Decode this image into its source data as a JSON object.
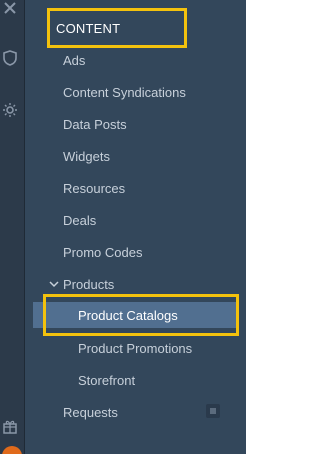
{
  "rail": {
    "icons": [
      "close-icon",
      "shield-icon",
      "settings-icon",
      "gift-icon"
    ],
    "avatar_color": "#e06a1b"
  },
  "sidebar": {
    "section_title": "CONTENT",
    "items": [
      {
        "label": "Ads"
      },
      {
        "label": "Content Syndications"
      },
      {
        "label": "Data Posts"
      },
      {
        "label": "Widgets"
      },
      {
        "label": "Resources"
      },
      {
        "label": "Deals"
      },
      {
        "label": "Promo Codes"
      },
      {
        "label": "Products",
        "expanded": true
      },
      {
        "label": "Product Catalogs",
        "active": true
      },
      {
        "label": "Product Promotions"
      },
      {
        "label": "Storefront"
      },
      {
        "label": "Requests"
      }
    ]
  },
  "colors": {
    "sidebar_bg": "#33475b",
    "rail_bg": "#2c3a4a",
    "active_bg": "#516f90",
    "highlight": "#f4c20d",
    "text": "#c7d0da"
  }
}
